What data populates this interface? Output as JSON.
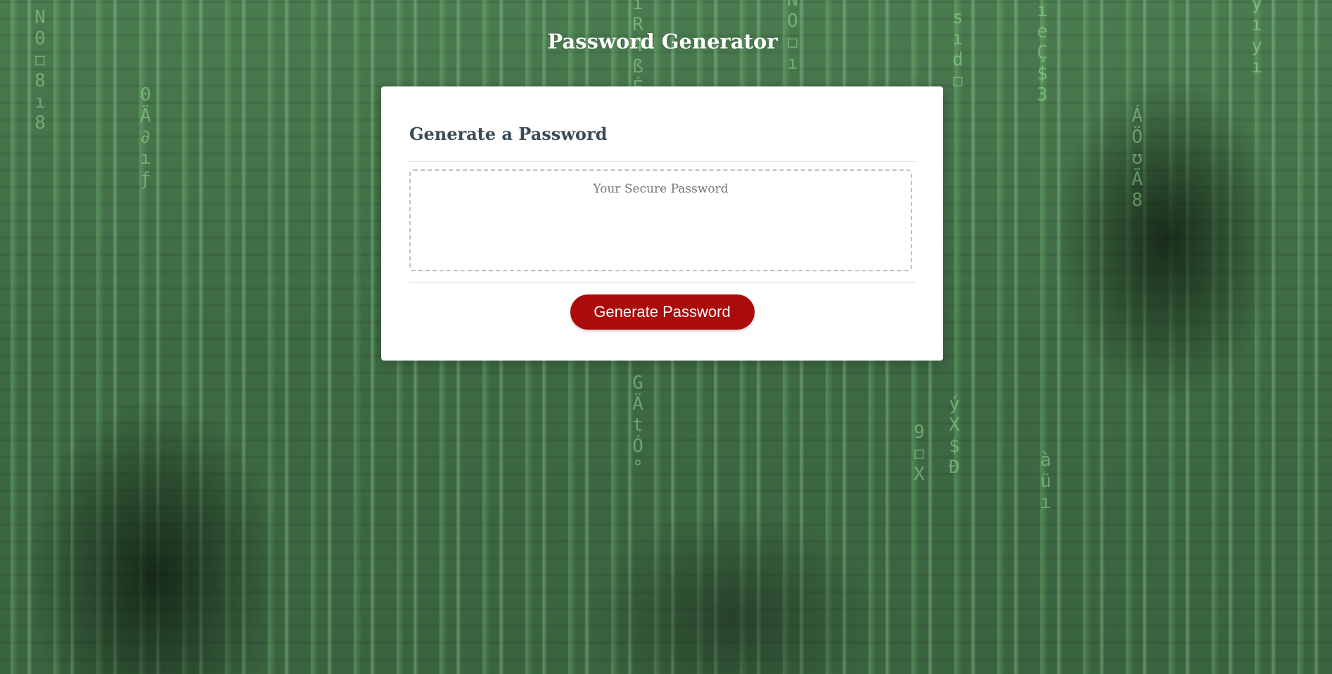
{
  "page": {
    "title": "Password Generator"
  },
  "card": {
    "title": "Generate a Password",
    "password_field": {
      "value": "",
      "placeholder": "Your Secure Password"
    },
    "generate_button_label": "Generate Password"
  },
  "background": {
    "glyph_columns": [
      "N0◻8ı8",
      "0Ä∂ıƒ",
      "ıR4ßÉ",
      "NO◻ı",
      "sıd◻",
      "ıeÇ$3",
      "ÁÖʊÃ8",
      "yıyı",
      "GÄtÓ°",
      "ýX$Ð",
      "9◻X",
      "àüı"
    ]
  },
  "colors": {
    "button_bg": "#ab0b0b",
    "card_title": "#3c4a57",
    "page_title": "#ffffff",
    "background_green": "#3f6b44"
  }
}
